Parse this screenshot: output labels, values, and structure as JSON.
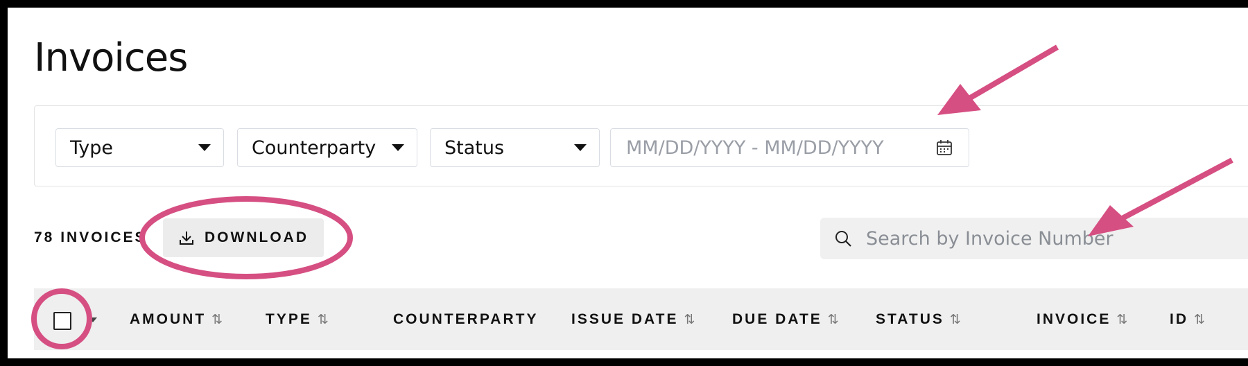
{
  "page": {
    "title": "Invoices"
  },
  "filters": {
    "type_label": "Type",
    "counterparty_label": "Counterparty",
    "status_label": "Status",
    "date_placeholder": "MM/DD/YYYY - MM/DD/YYYY"
  },
  "toolbar": {
    "count_label": "78 INVOICES",
    "download_label": "DOWNLOAD",
    "search_placeholder": "Search by Invoice Number"
  },
  "table": {
    "columns": [
      {
        "label": "AMOUNT",
        "sortable": true
      },
      {
        "label": "TYPE",
        "sortable": true
      },
      {
        "label": "COUNTERPARTY",
        "sortable": false
      },
      {
        "label": "ISSUE DATE",
        "sortable": true
      },
      {
        "label": "DUE DATE",
        "sortable": true
      },
      {
        "label": "STATUS",
        "sortable": true
      },
      {
        "label": "INVOICE",
        "sortable": true
      },
      {
        "label": "ID",
        "sortable": true
      }
    ],
    "sort_icon": "sort-arrows-icon"
  },
  "annotations": {
    "color": "#d64f82"
  }
}
